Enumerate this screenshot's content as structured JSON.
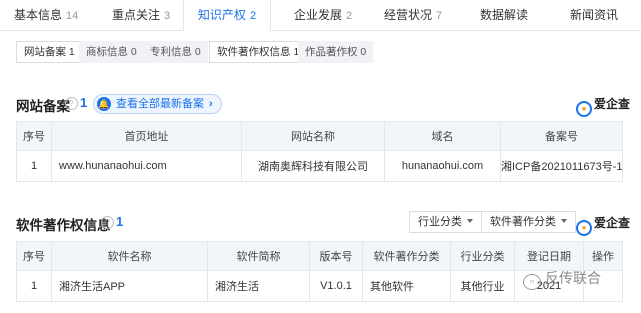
{
  "tabs": [
    {
      "label": "基本信息",
      "count": "14"
    },
    {
      "label": "重点关注",
      "count": "3"
    },
    {
      "label": "知识产权",
      "count": "2"
    },
    {
      "label": "企业发展",
      "count": "2"
    },
    {
      "label": "经营状况",
      "count": "7"
    },
    {
      "label": "数据解读",
      "count": ""
    },
    {
      "label": "新闻资讯",
      "count": ""
    }
  ],
  "chips": [
    {
      "label": "网站备案 1"
    },
    {
      "label": "商标信息 0"
    },
    {
      "label": "专利信息 0"
    },
    {
      "label": "软件著作权信息 1"
    },
    {
      "label": "作品著作权 0"
    }
  ],
  "website": {
    "title": "网站备案",
    "help": "?",
    "count": "1",
    "see_all": "查看全部最新备案",
    "brand": "爱企查",
    "headers": [
      "序号",
      "首页地址",
      "网站名称",
      "域名",
      "备案号"
    ],
    "rows": [
      [
        "1",
        "www.hunanaohui.com",
        "湖南奥辉科技有限公司",
        "hunanaohui.com",
        "湘ICP备2021011673号-1"
      ]
    ]
  },
  "software": {
    "title": "软件著作权信息",
    "help": "?",
    "count": "1",
    "filter_industry": "行业分类",
    "filter_type": "软件著作分类",
    "brand": "爱企查",
    "headers": [
      "序号",
      "软件名称",
      "软件简称",
      "版本号",
      "软件著作分类",
      "行业分类",
      "登记日期",
      "操作"
    ],
    "rows": [
      [
        "1",
        "湘济生活APP",
        "湘济生活",
        "V1.0.1",
        "其他软件",
        "其他行业",
        "2021",
        ""
      ]
    ]
  },
  "watermark": "反传联合",
  "colors": {
    "accent": "#1a73e8",
    "header_bg": "#f2f6fb",
    "border": "#e4e7ed"
  },
  "icons": {
    "help": "question-circle-icon",
    "bell": "bell-icon",
    "chevron": "chevron-right-icon",
    "caret": "caret-down-icon",
    "brand": "aiqicha-logo-icon"
  }
}
